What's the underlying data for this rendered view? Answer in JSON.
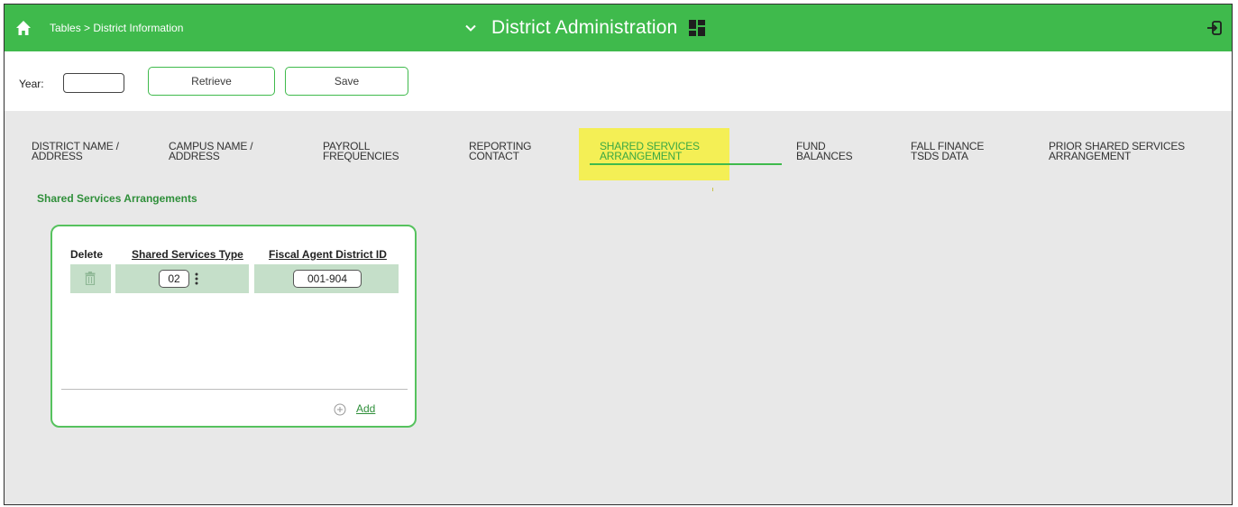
{
  "header": {
    "breadcrumb": "Tables > District Information",
    "app_title": "District Administration",
    "accent_color": "#3fba4c"
  },
  "toolbar": {
    "year_label": "Year:",
    "year_value": "",
    "retrieve_label": "Retrieve",
    "save_label": "Save"
  },
  "tabs": [
    {
      "line1": "District Name /",
      "line2": "Address"
    },
    {
      "line1": "Campus Name /",
      "line2": "Address"
    },
    {
      "line1": "Payroll",
      "line2": "Frequencies"
    },
    {
      "line1": "Reporting",
      "line2": "Contact"
    },
    {
      "line1": "Shared Services",
      "line2": "Arrangement",
      "active": true
    },
    {
      "line1": "Fund",
      "line2": "Balances"
    },
    {
      "line1": "Fall Finance",
      "line2": "TSDS Data"
    },
    {
      "line1": "Prior Shared Services",
      "line2": "Arrangement"
    }
  ],
  "section": {
    "title": "Shared Services Arrangements"
  },
  "grid": {
    "headers": {
      "delete": "Delete",
      "type": "Shared Services Type",
      "agent": "Fiscal Agent District ID"
    },
    "rows": [
      {
        "type": "02",
        "agent": "001-904"
      }
    ],
    "add_label": "Add"
  },
  "icons": [
    "home-icon",
    "chevron-down-icon",
    "grid-icon",
    "exit-icon",
    "trash-icon",
    "lookup-icon",
    "add-icon"
  ]
}
